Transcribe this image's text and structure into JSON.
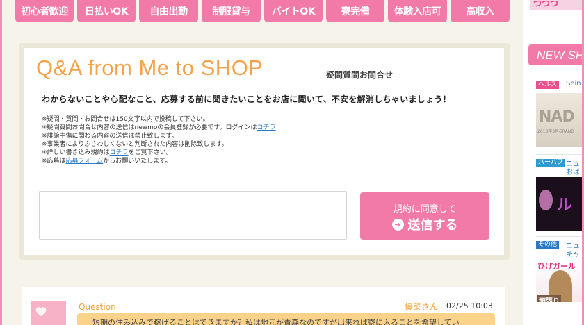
{
  "tags": [
    "初心者歓迎",
    "日払いOK",
    "自由出勤",
    "制服貸与",
    "バイトOK",
    "寮完備",
    "体験入店可",
    "高収入"
  ],
  "qa": {
    "title": "Q&A  from Me to SHOP",
    "subtitle": "疑問質問お問合せ",
    "lead": "わからないことや心配なこと、応募する前に聞きたいことをお店に聞いて、不安を解消しちゃいましょう！",
    "notes": [
      {
        "text": "※疑問・質問・お問合せは150文字以内で投稿して下さい。",
        "link": ""
      },
      {
        "text": "※疑問質問お問合せ内容の送信はnewmoの会員登録が必要です。ログインは",
        "link": "コチラ",
        "tail": ""
      },
      {
        "text": "※誹謗中傷に関わる内容の送信は禁止致します。",
        "link": ""
      },
      {
        "text": "※事業者によりふさわしくないと判断された内容は削除致します。",
        "link": ""
      },
      {
        "text": "※詳しい書き込み規約は",
        "link": "コチラ",
        "tail": "をご覧下さい。"
      },
      {
        "text": "※応募は",
        "link": "応募フォーム",
        "tail": "からお願いいたします。"
      }
    ],
    "textarea_value": "",
    "send_top": "規約に同意して",
    "send_main": "送信する",
    "send_icon": "arrow-circle-icon"
  },
  "question": {
    "label": "Question",
    "user": "優菜さん",
    "date": "02/25 10:03",
    "text": "短期の住み込みで稼げることはできますか？私は地元が青森なのですが出来れば寮に入ることを希望してい"
  },
  "sidebar": {
    "banner_text": "つつつ",
    "new_shop": "NEW SH",
    "items": [
      {
        "category": "ヘルス",
        "name": "Sein",
        "category_color": "#e94f8c",
        "image_text": "NAD",
        "image_sub": "2013年3月GRAND"
      },
      {
        "category": "パーパブ",
        "name": "ニュ",
        "name2": "おば",
        "category_color": "#2f9ad0",
        "image_text": "ル"
      },
      {
        "category": "その他",
        "name": "ニュ",
        "name2": "キャ",
        "category_color": "#2b79c6",
        "image_text": "ひげガール",
        "image_sub": "頑張り"
      }
    ]
  },
  "colors": {
    "accent_pink": "#f27aa8",
    "orange": "#f6a24a",
    "bubble": "#fad28a",
    "link": "#2b79c6"
  }
}
